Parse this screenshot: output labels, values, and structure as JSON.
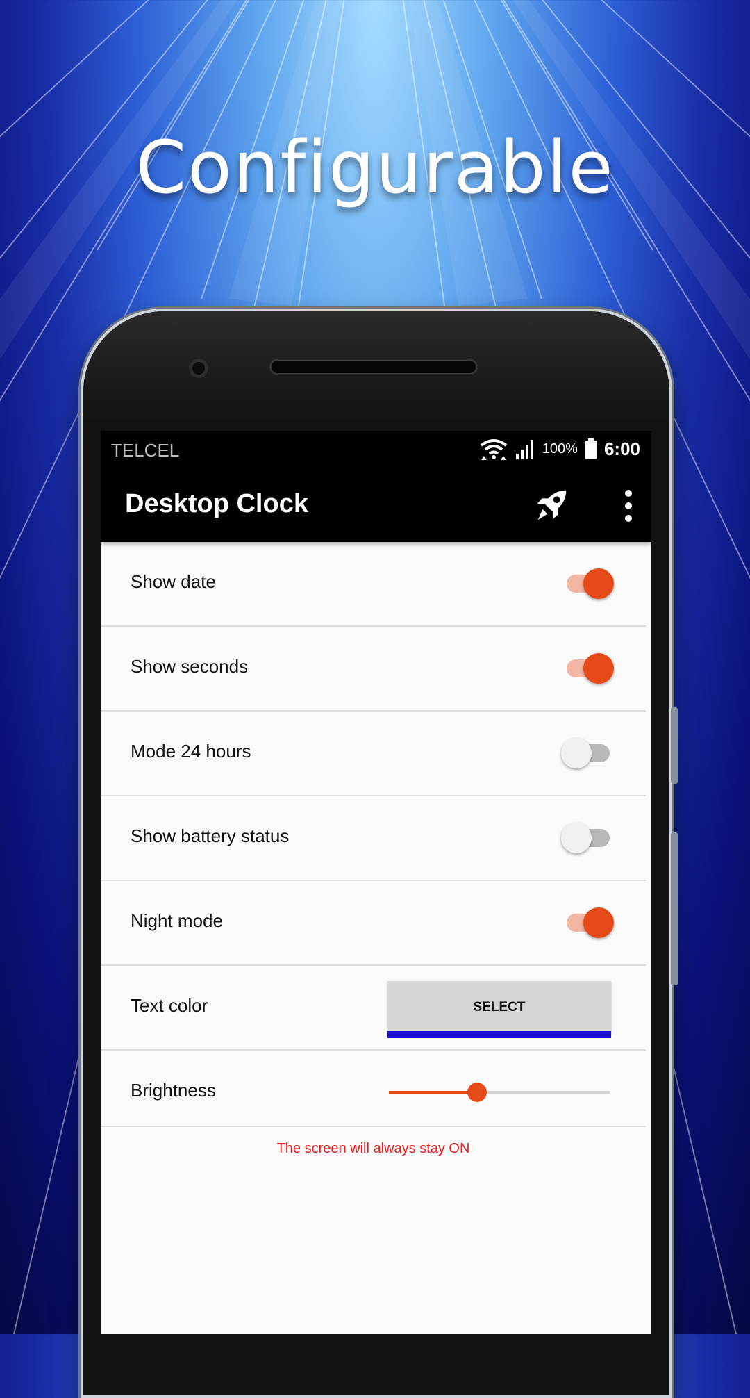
{
  "headline": "Configurable",
  "status_bar": {
    "carrier": "TELCEL",
    "battery_percent": "100%",
    "time": "6:00",
    "icons": [
      "wifi-icon",
      "signal-icon",
      "battery-icon"
    ]
  },
  "toolbar": {
    "title": "Desktop Clock",
    "actions": [
      "rocket-icon",
      "more-vert-icon"
    ]
  },
  "settings": [
    {
      "label": "Show date",
      "type": "switch",
      "on": true
    },
    {
      "label": "Show seconds",
      "type": "switch",
      "on": true
    },
    {
      "label": "Mode 24 hours",
      "type": "switch",
      "on": false
    },
    {
      "label": "Show battery status",
      "type": "switch",
      "on": false
    },
    {
      "label": "Night mode",
      "type": "switch",
      "on": true
    },
    {
      "label": "Text color",
      "type": "button",
      "button_label": "SELECT",
      "color": "#1d0fd6"
    },
    {
      "label": "Brightness",
      "type": "slider",
      "value": 0.4
    }
  ],
  "note": "The screen will always stay ON",
  "colors": {
    "accent": "#e64a19",
    "note": "#e81a1a",
    "toolbar_bg": "#000000"
  }
}
